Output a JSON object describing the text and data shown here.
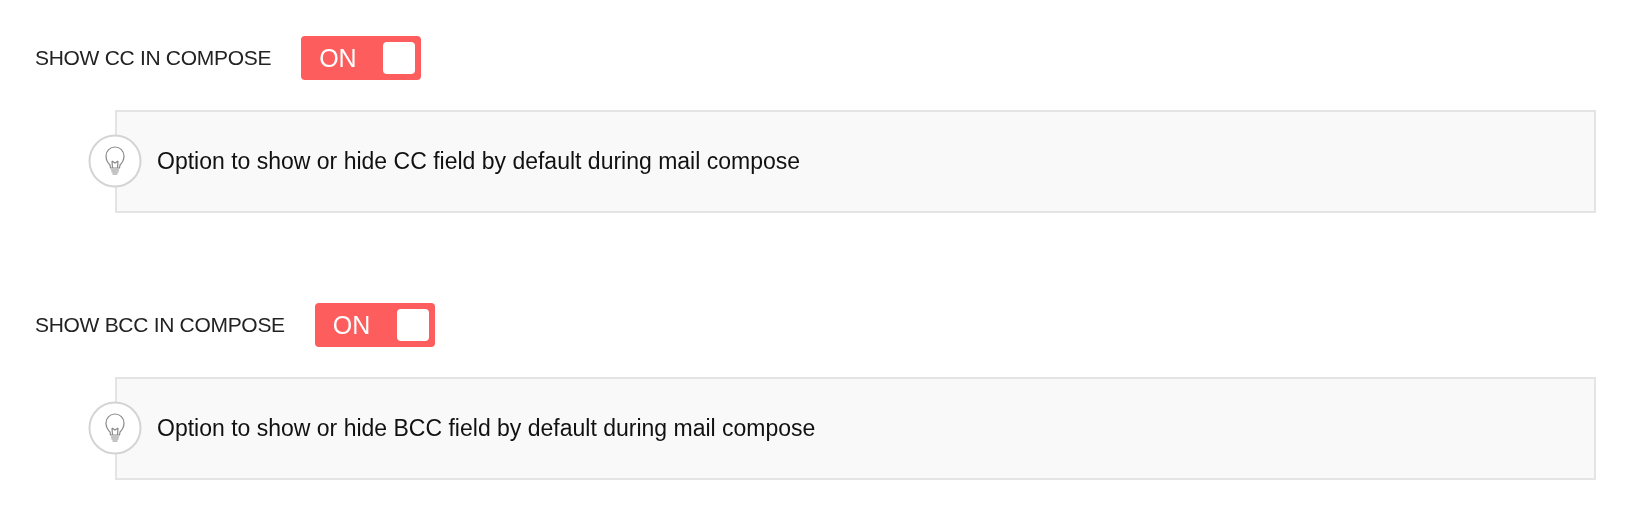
{
  "settings": [
    {
      "label": "SHOW CC IN COMPOSE",
      "toggle": {
        "text": "ON",
        "on": true
      },
      "hint": "Option to show or hide CC field by default during mail compose"
    },
    {
      "label": "SHOW BCC IN COMPOSE",
      "toggle": {
        "text": "ON",
        "on": true
      },
      "hint": "Option to show or hide BCC field by default during mail compose"
    }
  ]
}
